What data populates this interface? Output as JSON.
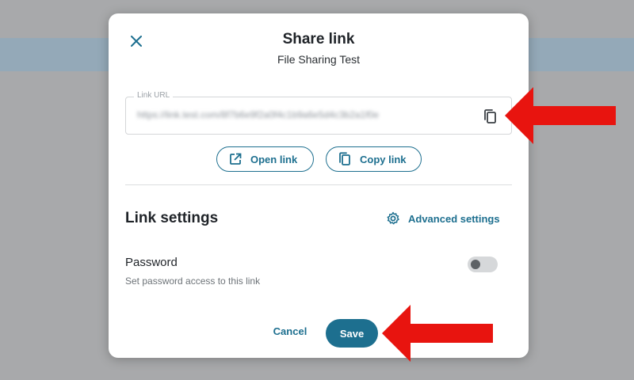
{
  "dialog": {
    "title": "Share link",
    "subtitle": "File Sharing Test",
    "close_icon": "close-icon"
  },
  "url_field": {
    "label": "Link URL",
    "value": "https://link.test.com/8f7b6e9f2a0f4c1b9a6e5d4c3b2a1f0e",
    "copy_icon": "copy-icon"
  },
  "actions": {
    "open_link": "Open link",
    "copy_link": "Copy link"
  },
  "settings": {
    "title": "Link settings",
    "advanced": "Advanced settings",
    "password": {
      "label": "Password",
      "description": "Set password access to this link",
      "enabled": false
    }
  },
  "footer": {
    "cancel": "Cancel",
    "save": "Save"
  },
  "colors": {
    "accent": "#1d6f8f",
    "backdrop": "#a8a9ab",
    "annotation_arrow": "#e8140f"
  }
}
